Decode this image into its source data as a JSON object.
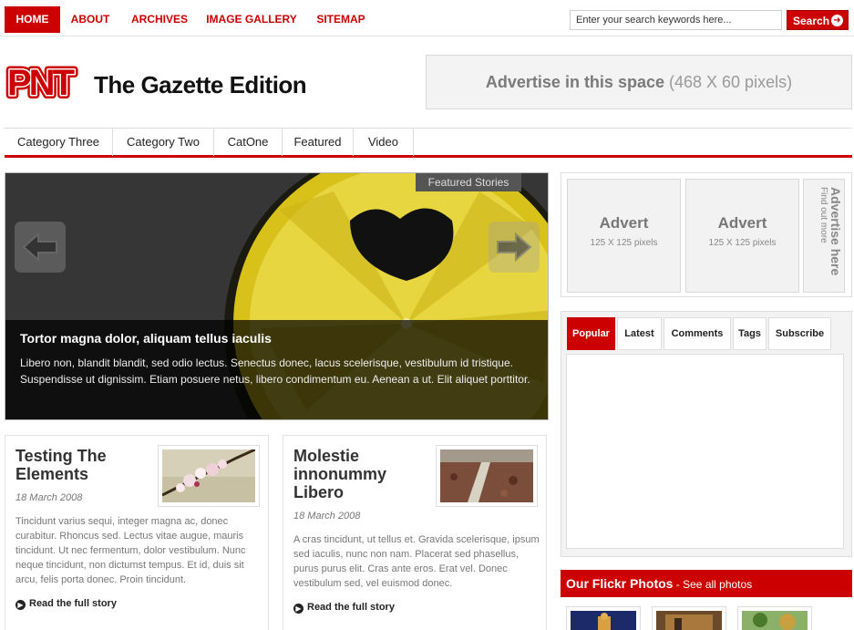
{
  "topnav": {
    "items": [
      {
        "label": "HOME",
        "active": true
      },
      {
        "label": "ABOUT"
      },
      {
        "label": "ARCHIVES"
      },
      {
        "label": "IMAGE GALLERY"
      },
      {
        "label": "SITEMAP"
      }
    ],
    "search_placeholder": "Enter your search keywords here...",
    "search_button": "Search",
    "search_icon": "arrow-right-circle-icon"
  },
  "header": {
    "logo_text": "PNT",
    "site_title": "The Gazette Edition",
    "ad_main": "Advertise in this space",
    "ad_dim": "(468 X 60 pixels)"
  },
  "categories": [
    "Category Three",
    "Category Two",
    "CatOne",
    "Featured",
    "Video"
  ],
  "slider": {
    "tag": "Featured Stories",
    "title": "Tortor magna dolor, aliquam tellus iaculis",
    "text": "Libero non, blandit blandit, sed odio lectus. Senectus donec, lacus scelerisque, vestibulum id tristique. Suspendisse ut dignissim. Etiam posuere netus, libero condimentum eu. Aenean a ut. Elit aliquet porttitor.",
    "prev_icon": "arrow-left-icon",
    "next_icon": "arrow-right-icon"
  },
  "posts": [
    {
      "title": "Testing The Elements",
      "date": "18 March 2008",
      "excerpt": "Tincidunt varius sequi, integer magna ac, donec curabitur. Rhoncus sed. Lectus vitae augue, mauris tincidunt. Ut nec fermentum, dolor vestibulum. Nunc neque tincidunt, non dictumst tempus. Et id, duis sit arcu, felis porta donec. Proin tincidunt.",
      "read_more": "Read the full story"
    },
    {
      "title": "Molestie innonummy Libero",
      "date": "18 March 2008",
      "excerpt": "A cras tincidunt, ut tellus et. Gravida scelerisque, ipsum sed iaculis, nunc non nam. Placerat sed phasellus, purus purus elit. Cras ante eros. Erat vel. Donec vestibulum sed, vel euismod donec.",
      "read_more": "Read the full story"
    }
  ],
  "sidebar": {
    "adverts": [
      {
        "title": "Advert",
        "sub": "125 X 125 pixels"
      },
      {
        "title": "Advert",
        "sub": "125 X 125 pixels"
      }
    ],
    "advertise_here": "Advertise here",
    "find_out_more": "Find out more",
    "tabs": [
      {
        "label": "Popular",
        "active": true
      },
      {
        "label": "Latest"
      },
      {
        "label": "Comments"
      },
      {
        "label": "Tags"
      },
      {
        "label": "Subscribe"
      }
    ],
    "flickr_title": "Our Flickr Photos",
    "flickr_link": " - See all photos"
  },
  "colors": {
    "accent": "#cc0000",
    "text": "#333333"
  }
}
